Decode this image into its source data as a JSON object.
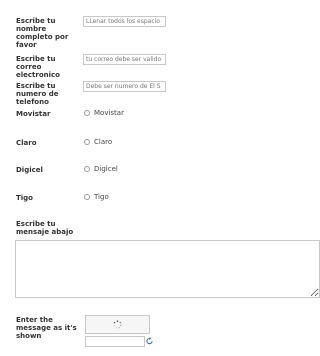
{
  "form": {
    "name": {
      "label": "Escribe tu nombre completo por favor",
      "placeholder": "LLenar todos los espacio"
    },
    "email": {
      "label": "Escribe tu correo electronico",
      "placeholder": "tu correo debe ser valido"
    },
    "phone": {
      "label": "Escribe tu numero de telefono",
      "placeholder": "Debe ser numero de El S"
    },
    "carriers": [
      {
        "group_label": "Movistar",
        "option_label": "Movistar"
      },
      {
        "group_label": "Claro",
        "option_label": "Claro"
      },
      {
        "group_label": "Digicel",
        "option_label": "Digicel"
      },
      {
        "group_label": "Tigo",
        "option_label": "Tigo"
      }
    ],
    "message": {
      "label": "Escribe tu mensaje abajo",
      "value": ""
    },
    "captcha": {
      "label": "Enter the message as it's shown",
      "value": ""
    }
  },
  "icons": {
    "captcha_loading": "spinner-icon",
    "captcha_refresh": "refresh-icon"
  }
}
